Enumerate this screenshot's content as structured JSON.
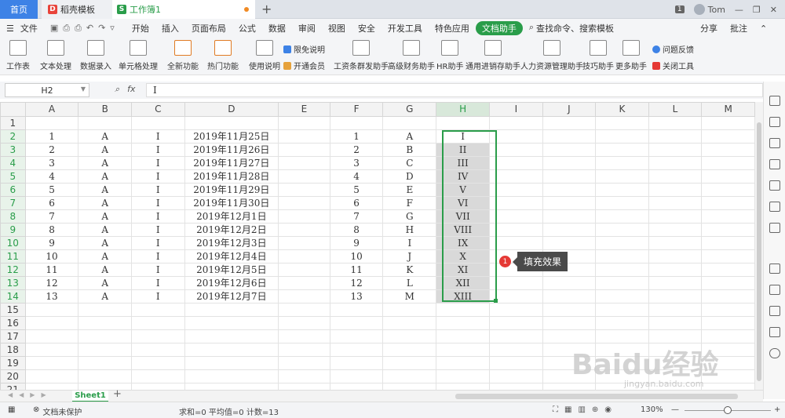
{
  "tabs": {
    "home": "首页",
    "template": "稻壳模板",
    "workbook": "工作簿1"
  },
  "window": {
    "badge": "1",
    "user": "Tom"
  },
  "menu": {
    "items": [
      "文件",
      "开始",
      "插入",
      "页面布局",
      "公式",
      "数据",
      "审阅",
      "视图",
      "安全",
      "开发工具",
      "特色应用",
      "文档助手"
    ],
    "active_index": 11,
    "search": "查找命令、搜索模板",
    "share": "分享",
    "comment": "批注"
  },
  "ribbon": {
    "buttons": [
      "工作表",
      "文本处理",
      "数据录入",
      "单元格处理",
      "全新功能",
      "热门功能",
      "使用说明",
      "工资条群发助手",
      "高级财务助手",
      "HR助手",
      "通用进销存助手",
      "人力资源管理助手",
      "技巧助手",
      "更多助手"
    ],
    "small": {
      "free": "限免说明",
      "vip": "开通会员",
      "feedback": "问题反馈",
      "close": "关闭工具"
    }
  },
  "formula": {
    "cell": "H2",
    "fx": "fx",
    "value": "I"
  },
  "sheet": {
    "columns": [
      "A",
      "B",
      "C",
      "D",
      "E",
      "F",
      "G",
      "H",
      "I",
      "J",
      "K",
      "L",
      "M"
    ],
    "rows": [
      [
        "",
        "",
        "",
        "",
        "",
        "",
        "",
        ""
      ],
      [
        "1",
        "A",
        "I",
        "2019年11月25日",
        "",
        "1",
        "A",
        "I"
      ],
      [
        "2",
        "A",
        "I",
        "2019年11月26日",
        "",
        "2",
        "B",
        "II"
      ],
      [
        "3",
        "A",
        "I",
        "2019年11月27日",
        "",
        "3",
        "C",
        "III"
      ],
      [
        "4",
        "A",
        "I",
        "2019年11月28日",
        "",
        "4",
        "D",
        "IV"
      ],
      [
        "5",
        "A",
        "I",
        "2019年11月29日",
        "",
        "5",
        "E",
        "V"
      ],
      [
        "6",
        "A",
        "I",
        "2019年11月30日",
        "",
        "6",
        "F",
        "VI"
      ],
      [
        "7",
        "A",
        "I",
        "2019年12月1日",
        "",
        "7",
        "G",
        "VII"
      ],
      [
        "8",
        "A",
        "I",
        "2019年12月2日",
        "",
        "8",
        "H",
        "VIII"
      ],
      [
        "9",
        "A",
        "I",
        "2019年12月3日",
        "",
        "9",
        "I",
        "IX"
      ],
      [
        "10",
        "A",
        "I",
        "2019年12月4日",
        "",
        "10",
        "J",
        "X"
      ],
      [
        "11",
        "A",
        "I",
        "2019年12月5日",
        "",
        "11",
        "K",
        "XI"
      ],
      [
        "12",
        "A",
        "I",
        "2019年12月6日",
        "",
        "12",
        "L",
        "XII"
      ],
      [
        "13",
        "A",
        "I",
        "2019年12月7日",
        "",
        "13",
        "M",
        "XIII"
      ],
      [
        "",
        "",
        "",
        "",
        "",
        "",
        "",
        ""
      ],
      [
        "",
        "",
        "",
        "",
        "",
        "",
        "",
        ""
      ],
      [
        "",
        "",
        "",
        "",
        "",
        "",
        "",
        ""
      ],
      [
        "",
        "",
        "",
        "",
        "",
        "",
        "",
        ""
      ],
      [
        "",
        "",
        "",
        "",
        "",
        "",
        "",
        ""
      ],
      [
        "",
        "",
        "",
        "",
        "",
        "",
        "",
        ""
      ],
      [
        "",
        "",
        "",
        "",
        "",
        "",
        "",
        ""
      ]
    ],
    "selected_column": "H",
    "selected_rows": [
      2,
      14
    ]
  },
  "annotation": {
    "number": "1",
    "label": "填充效果"
  },
  "sheet_tabs": {
    "active": "Sheet1"
  },
  "status": {
    "protect": "文档未保护",
    "stats": "求和=0 平均值=0 计数=13",
    "zoom": "130%"
  },
  "watermark": {
    "main": "Baidu经验",
    "sub": "jingyan.baidu.com"
  },
  "colors": {
    "accent": "#2a9d4a",
    "home_tab": "#3d82e6",
    "badge_red": "#e53935"
  }
}
